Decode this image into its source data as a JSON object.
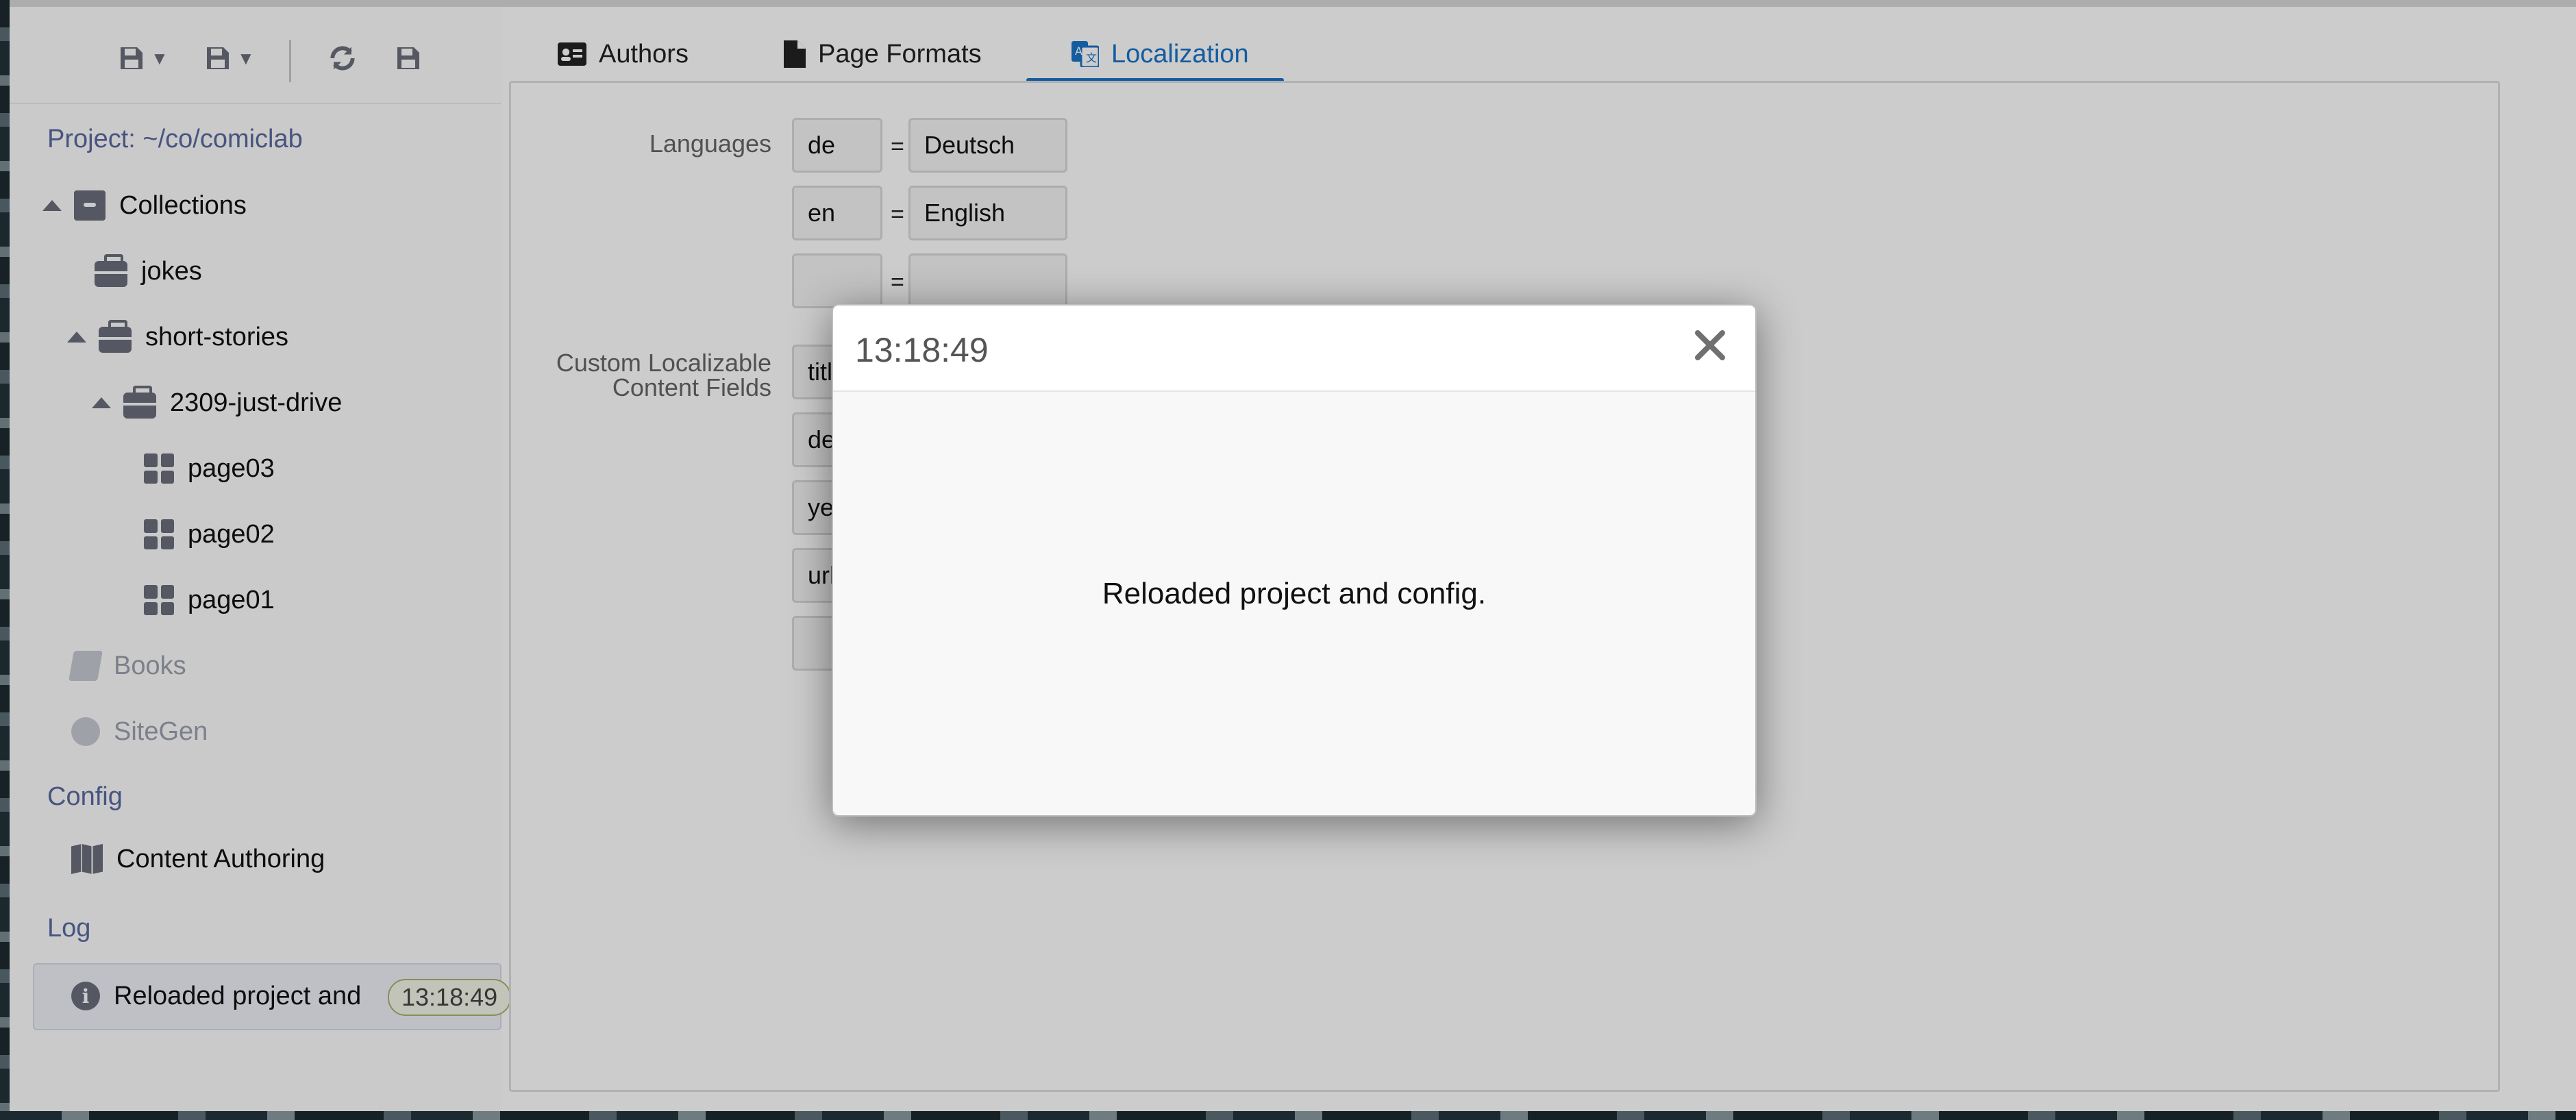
{
  "toolbar": {
    "items": [
      {
        "name": "save-menu-icon"
      },
      {
        "name": "save-as-menu-icon"
      },
      {
        "name": "reload-icon"
      },
      {
        "name": "save-icon"
      }
    ]
  },
  "sidebar": {
    "project": "Project: ~/co/comiclab",
    "collections": "Collections",
    "tree": {
      "jokes": "jokes",
      "short_stories": "short-stories",
      "just_drive": "2309-just-drive",
      "page03": "page03",
      "page02": "page02",
      "page01": "page01"
    },
    "books": "Books",
    "sitegen": "SiteGen",
    "config_header": "Config",
    "content_authoring": "Content Authoring",
    "log_header": "Log",
    "log_item": {
      "text": "Reloaded project and",
      "time": "13:18:49"
    }
  },
  "tabs": [
    {
      "label": "Authors",
      "icon": "id-card-icon"
    },
    {
      "label": "Page Formats",
      "icon": "file-icon"
    },
    {
      "label": "Localization",
      "icon": "translate-icon",
      "active": true
    }
  ],
  "localization": {
    "languages_label": "Languages",
    "languages": [
      {
        "code": "de",
        "name": "Deutsch"
      },
      {
        "code": "en",
        "name": "English"
      },
      {
        "code": "",
        "name": ""
      }
    ],
    "eq": "=",
    "custom_label_line1": "Custom Localizable",
    "custom_label_line2": "Content Fields",
    "custom_fields": [
      "titl",
      "de",
      "ye",
      "url",
      ""
    ]
  },
  "modal": {
    "title": "13:18:49",
    "message": "Reloaded project and config."
  },
  "colors": {
    "accent": "#1a73c9",
    "icon": "#6b6f7c",
    "project": "#5b6aa0"
  }
}
